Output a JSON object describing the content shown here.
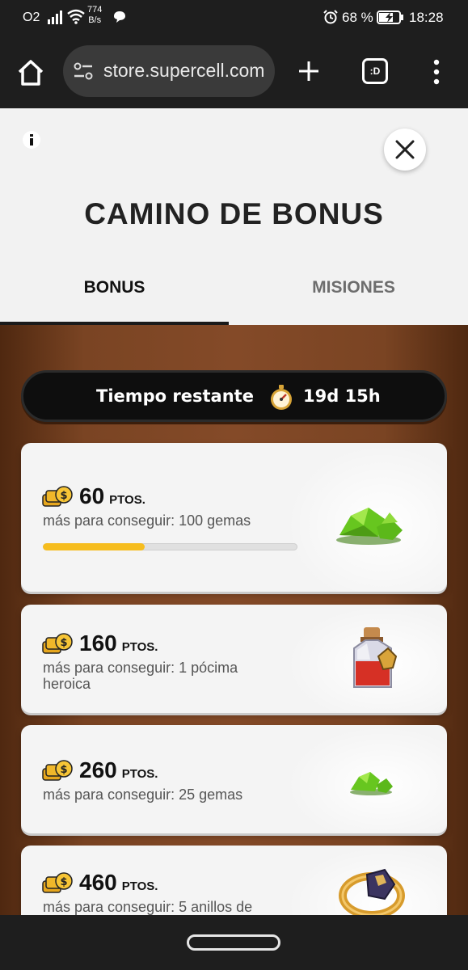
{
  "status_bar": {
    "carrier": "O2",
    "net_speed_value": "774",
    "net_speed_unit": "B/s",
    "battery_percent": "68 %",
    "time": "18:28"
  },
  "browser": {
    "url": "store.supercell.com",
    "tab_switcher_label": ":D"
  },
  "page": {
    "title": "CAMINO DE BONUS",
    "tabs": [
      {
        "label": "BONUS",
        "active": true
      },
      {
        "label": "MISIONES",
        "active": false
      }
    ],
    "timer": {
      "label": "Tiempo restante",
      "value": "19d 15h"
    },
    "rewards": [
      {
        "points": "60",
        "unit": "PTOS.",
        "description": "más para conseguir: 100 gemas",
        "progress": 0.4,
        "icon": "gems-pile-icon"
      },
      {
        "points": "160",
        "unit": "PTOS.",
        "description": "más para conseguir: 1 pócima heroica",
        "icon": "hero-potion-icon"
      },
      {
        "points": "260",
        "unit": "PTOS.",
        "description": "más para conseguir: 25 gemas",
        "icon": "gems-small-icon"
      },
      {
        "points": "460",
        "unit": "PTOS.",
        "description": "más para conseguir: 5 anillos de",
        "icon": "ring-icon"
      }
    ]
  },
  "colors": {
    "progress_fill": "#f6bd1e",
    "wood_background": "#7a4423",
    "timer_pill": "#0e0e0e"
  }
}
